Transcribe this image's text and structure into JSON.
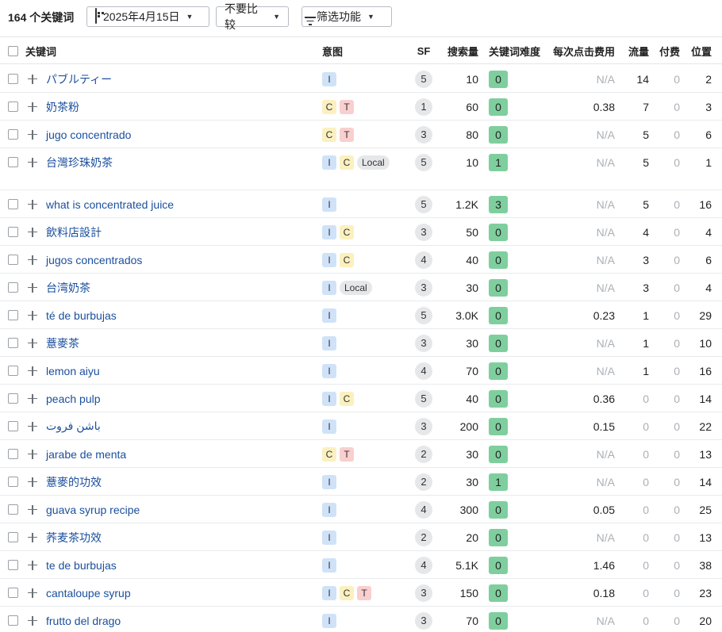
{
  "toolbar": {
    "keyword_count": "164 个关键词",
    "date": "2025年4月15日",
    "compare": "不要比较",
    "filter": "筛选功能"
  },
  "columns": {
    "keyword": "关键词",
    "intent": "意图",
    "sf": "SF",
    "volume": "搜索量",
    "kd": "关键词难度",
    "cpc": "每次点击费用",
    "traffic": "流量",
    "paid": "付费",
    "position": "位置"
  },
  "colors": {
    "kd_green": "#7fcf9e",
    "link": "#1a4f9e",
    "intent_I": "#cfe2f8",
    "intent_C": "#fbf0c0",
    "intent_T": "#f9cfcf"
  },
  "rows": [
    {
      "keyword": "パブルティー",
      "intent": [
        "I"
      ],
      "sf": "5",
      "volume": "10",
      "kd": "0",
      "cpc": "N/A",
      "traffic": "14",
      "paid": "0",
      "position": "2"
    },
    {
      "keyword": "奶茶粉",
      "intent": [
        "C",
        "T"
      ],
      "sf": "1",
      "volume": "60",
      "kd": "0",
      "cpc": "0.38",
      "traffic": "7",
      "paid": "0",
      "position": "3"
    },
    {
      "keyword": "jugo concentrado",
      "intent": [
        "C",
        "T"
      ],
      "sf": "3",
      "volume": "80",
      "kd": "0",
      "cpc": "N/A",
      "traffic": "5",
      "paid": "0",
      "position": "6"
    },
    {
      "keyword": "台灣珍珠奶茶",
      "intent": [
        "I",
        "C",
        "Local"
      ],
      "sf": "5",
      "volume": "10",
      "kd": "1",
      "cpc": "N/A",
      "traffic": "5",
      "paid": "0",
      "position": "1"
    },
    {
      "keyword": "what is concentrated juice",
      "intent": [
        "I"
      ],
      "sf": "5",
      "volume": "1.2K",
      "kd": "3",
      "cpc": "N/A",
      "traffic": "5",
      "paid": "0",
      "position": "16"
    },
    {
      "keyword": "飲料店設計",
      "intent": [
        "I",
        "C"
      ],
      "sf": "3",
      "volume": "50",
      "kd": "0",
      "cpc": "N/A",
      "traffic": "4",
      "paid": "0",
      "position": "4"
    },
    {
      "keyword": "jugos concentrados",
      "intent": [
        "I",
        "C"
      ],
      "sf": "4",
      "volume": "40",
      "kd": "0",
      "cpc": "N/A",
      "traffic": "3",
      "paid": "0",
      "position": "6"
    },
    {
      "keyword": "台湾奶茶",
      "intent": [
        "I",
        "Local"
      ],
      "sf": "3",
      "volume": "30",
      "kd": "0",
      "cpc": "N/A",
      "traffic": "3",
      "paid": "0",
      "position": "4"
    },
    {
      "keyword": "té de burbujas",
      "intent": [
        "I"
      ],
      "sf": "5",
      "volume": "3.0K",
      "kd": "0",
      "cpc": "0.23",
      "traffic": "1",
      "paid": "0",
      "position": "29"
    },
    {
      "keyword": "薏麥茶",
      "intent": [
        "I"
      ],
      "sf": "3",
      "volume": "30",
      "kd": "0",
      "cpc": "N/A",
      "traffic": "1",
      "paid": "0",
      "position": "10"
    },
    {
      "keyword": "lemon aiyu",
      "intent": [
        "I"
      ],
      "sf": "4",
      "volume": "70",
      "kd": "0",
      "cpc": "N/A",
      "traffic": "1",
      "paid": "0",
      "position": "16"
    },
    {
      "keyword": "peach pulp",
      "intent": [
        "I",
        "C"
      ],
      "sf": "5",
      "volume": "40",
      "kd": "0",
      "cpc": "0.36",
      "traffic": "0",
      "paid": "0",
      "position": "14"
    },
    {
      "keyword": "باشن فروت",
      "intent": [
        "I"
      ],
      "sf": "3",
      "volume": "200",
      "kd": "0",
      "cpc": "0.15",
      "traffic": "0",
      "paid": "0",
      "position": "22"
    },
    {
      "keyword": "jarabe de menta",
      "intent": [
        "C",
        "T"
      ],
      "sf": "2",
      "volume": "30",
      "kd": "0",
      "cpc": "N/A",
      "traffic": "0",
      "paid": "0",
      "position": "13"
    },
    {
      "keyword": "薏麥的功效",
      "intent": [
        "I"
      ],
      "sf": "2",
      "volume": "30",
      "kd": "1",
      "cpc": "N/A",
      "traffic": "0",
      "paid": "0",
      "position": "14"
    },
    {
      "keyword": "guava syrup recipe",
      "intent": [
        "I"
      ],
      "sf": "4",
      "volume": "300",
      "kd": "0",
      "cpc": "0.05",
      "traffic": "0",
      "paid": "0",
      "position": "25"
    },
    {
      "keyword": "荞麦茶功效",
      "intent": [
        "I"
      ],
      "sf": "2",
      "volume": "20",
      "kd": "0",
      "cpc": "N/A",
      "traffic": "0",
      "paid": "0",
      "position": "13"
    },
    {
      "keyword": "te de burbujas",
      "intent": [
        "I"
      ],
      "sf": "4",
      "volume": "5.1K",
      "kd": "0",
      "cpc": "1.46",
      "traffic": "0",
      "paid": "0",
      "position": "38"
    },
    {
      "keyword": "cantaloupe syrup",
      "intent": [
        "I",
        "C",
        "T"
      ],
      "sf": "3",
      "volume": "150",
      "kd": "0",
      "cpc": "0.18",
      "traffic": "0",
      "paid": "0",
      "position": "23"
    },
    {
      "keyword": "frutto del drago",
      "intent": [
        "I"
      ],
      "sf": "3",
      "volume": "70",
      "kd": "0",
      "cpc": "N/A",
      "traffic": "0",
      "paid": "0",
      "position": "20"
    }
  ]
}
